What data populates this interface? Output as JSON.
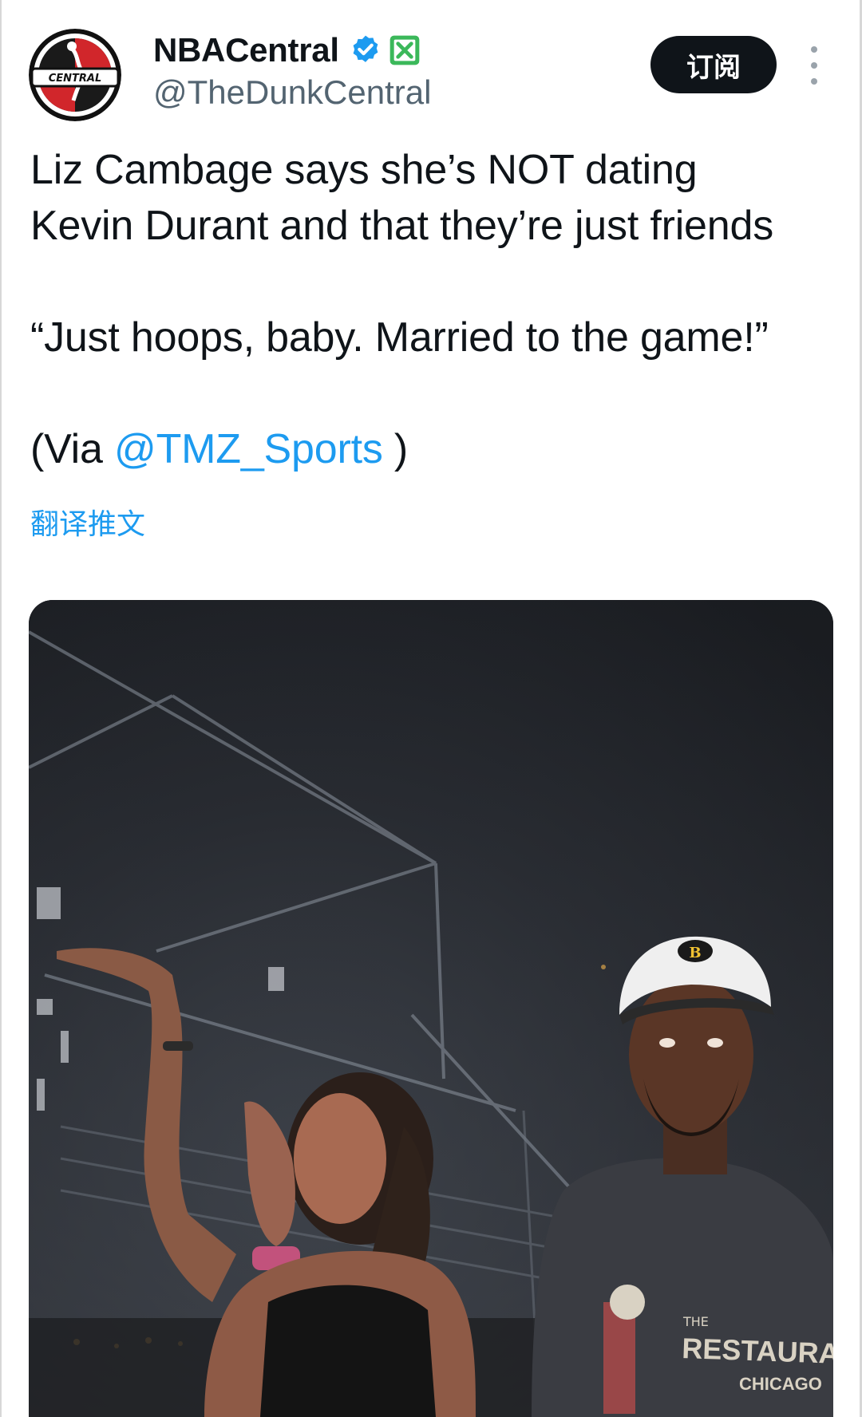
{
  "account": {
    "display_name": "NBACentral",
    "handle": "@TheDunkCentral",
    "avatar_text": "CENTRAL",
    "verified_icon": "verified-badge-icon",
    "affiliate_icon": "x-affiliate-icon",
    "verified_color": "#1d9bf0",
    "affiliate_color": "#3bb85a"
  },
  "actions": {
    "subscribe_label": "订阅",
    "more_icon": "more-vertical-icon"
  },
  "tweet": {
    "line1": "Liz Cambage says she’s NOT dating",
    "line2": "Kevin Durant and that they’re just friends",
    "quote": "“Just hoops, baby. Married to the game!”",
    "via_prefix": "(Via ",
    "via_mention": "@TMZ_Sports",
    "via_suffix": " )",
    "translate_label": "翻译推文",
    "link_color": "#1d9bf0"
  },
  "media": {
    "cap_logo": "B",
    "shirt_text_1": "THE",
    "shirt_text_2": "RESTAURANT",
    "shirt_text_3": "CHICAGO"
  }
}
